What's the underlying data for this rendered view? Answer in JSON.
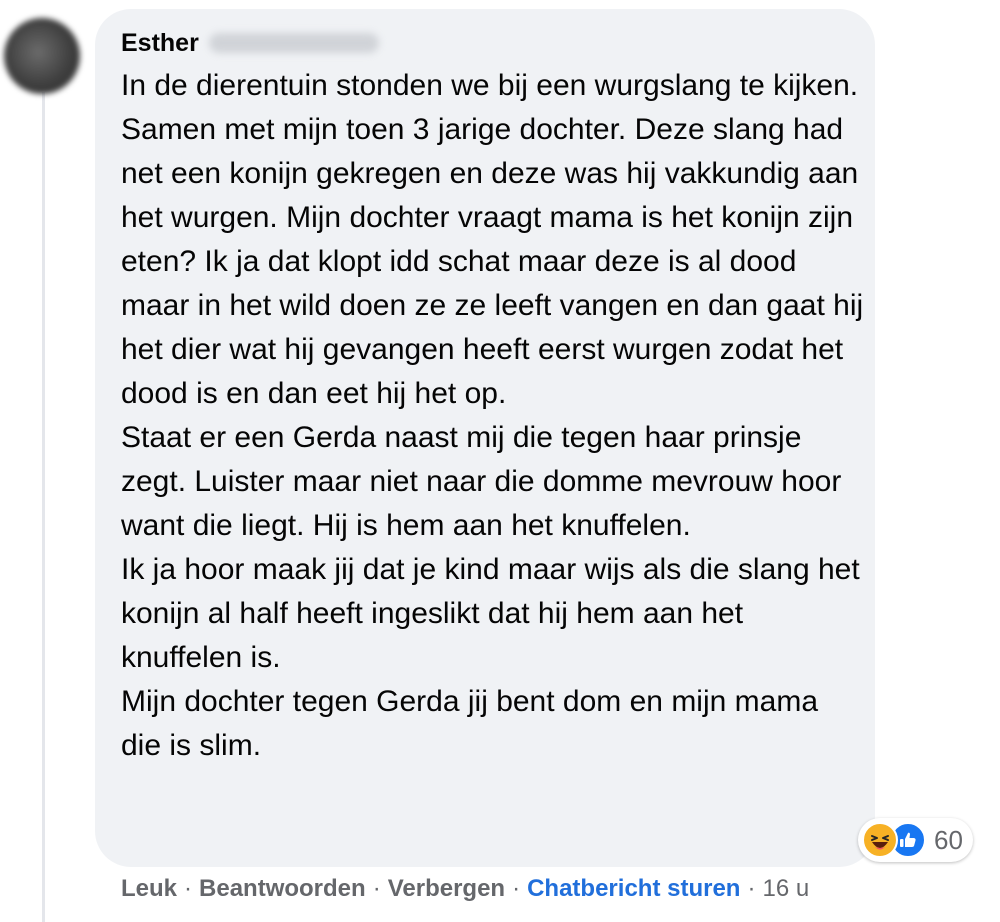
{
  "comment": {
    "author": "Esther",
    "paragraphs": [
      "In de dierentuin stonden we bij een wurgslang te kijken. Samen met mijn toen 3 jarige dochter. Deze slang had net een konijn gekregen en deze was hij vakkundig aan het wurgen. Mijn dochter vraagt mama is het konijn zijn eten? Ik ja dat klopt idd schat maar deze is al dood maar in het wild doen ze ze leeft vangen en dan gaat hij het dier wat hij gevangen heeft eerst wurgen zodat het dood is en dan eet hij het op.",
      "Staat er een Gerda naast mij die tegen haar prinsje zegt. Luister maar niet naar die domme mevrouw hoor want die liegt. Hij is hem aan het knuffelen.",
      "Ik ja hoor maak jij dat je kind maar wijs als die slang het konijn al half heeft ingeslikt dat hij hem aan het knuffelen is.",
      "Mijn dochter tegen Gerda jij bent dom en mijn mama die is slim."
    ]
  },
  "reactions": {
    "icons": [
      "haha-emoji-icon",
      "like-thumb-icon"
    ],
    "count": "60"
  },
  "actions": {
    "like": "Leuk",
    "reply": "Beantwoorden",
    "hide": "Verbergen",
    "message": "Chatbericht sturen",
    "separator": "·",
    "time": "16 u"
  },
  "colors": {
    "bubble": "#f0f2f5",
    "link_blue": "#216fdb",
    "meta_gray": "#65676b",
    "like_blue": "#1877f2",
    "haha_yellow": "#f7b125"
  }
}
